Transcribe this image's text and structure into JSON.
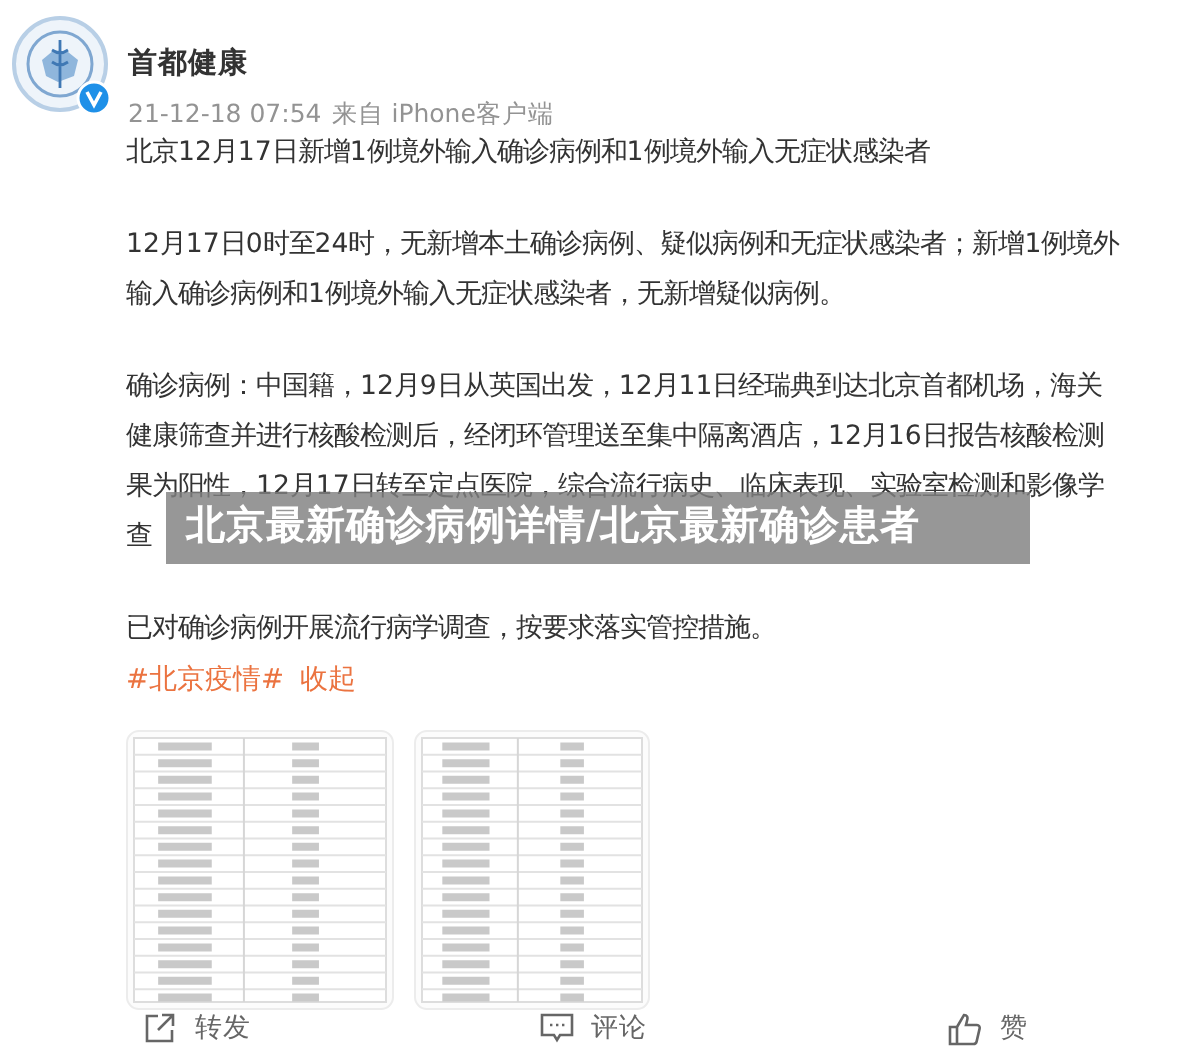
{
  "author": {
    "name": "首都健康",
    "verified": true
  },
  "meta": {
    "time": "21-12-18 07:54",
    "source": "来自 iPhone客户端"
  },
  "paragraphs": [
    {
      "lines": [
        "北京12月17日新增1例境外输入确诊病例和1例境外输入无症状感染者"
      ]
    },
    {
      "lines": [
        "12月17日0时至24时，无新增本土确诊病例、疑似病例和无症状感染者；新增1例境外",
        "输入确诊病例和1例境外输入无症状感染者，无新增疑似病例。"
      ]
    },
    {
      "lines": [
        "确诊病例：中国籍，12月9日从英国出发，12月11日经瑞典到达北京首都机场，海关",
        "健康筛查并进行核酸检测后，经闭环管理送至集中隔离酒店，12月16日报告核酸检测",
        "果为阳性，12月17日转至定点医院，综合流行病史、临床表现、实验室检测和影像学",
        "查"
      ]
    },
    {
      "lines": [
        "已对确诊病例开展流行病学调查，按要求落实管控措施。"
      ]
    }
  ],
  "tags": [
    {
      "text": "#北京疫情#",
      "kind": "hashtag"
    },
    {
      "text": "收起",
      "kind": "link"
    }
  ],
  "banner": {
    "text": "北京最新确诊病例详情/北京最新确诊患者"
  },
  "actions": [
    {
      "label": "转发",
      "kind": "share"
    },
    {
      "label": "评论",
      "kind": "comment"
    },
    {
      "label": "赞",
      "kind": "like"
    }
  ]
}
